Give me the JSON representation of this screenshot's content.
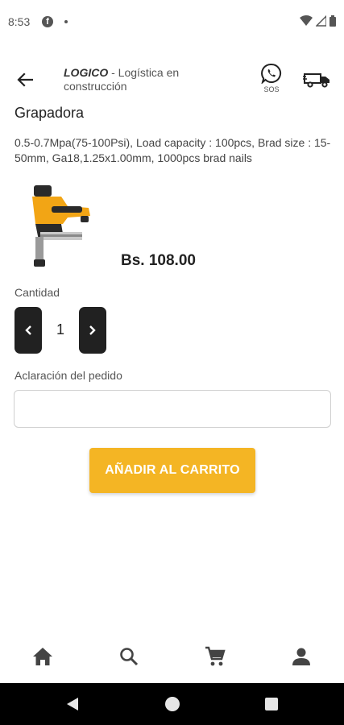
{
  "status_bar": {
    "time": "8:53",
    "fb_icon": "f"
  },
  "app_bar": {
    "brand": "LOGICO",
    "subtitle": " - Logística en construcción",
    "whatsapp_label": "SOS"
  },
  "product": {
    "title": "Grapadora",
    "description": "0.5-0.7Mpa(75-100Psi), Load capacity : 100pcs, Brad size : 15-50mm, Ga18,1.25x1.00mm, 1000pcs brad nails",
    "price": "Bs. 108.00"
  },
  "quantity": {
    "label": "Cantidad",
    "value": "1"
  },
  "note": {
    "label": "Aclaración del pedido",
    "value": "",
    "placeholder": ""
  },
  "add_to_cart": {
    "label": "AÑADIR AL CARRITO"
  },
  "icons": {
    "back": "arrow-back-icon",
    "whatsapp": "whatsapp-icon",
    "truck": "truck-icon",
    "home": "home-icon",
    "search": "search-icon",
    "cart": "cart-icon",
    "profile": "person-icon"
  },
  "colors": {
    "accent": "#f4b524",
    "qty_buttons": "#212121",
    "system_nav": "#000000"
  }
}
